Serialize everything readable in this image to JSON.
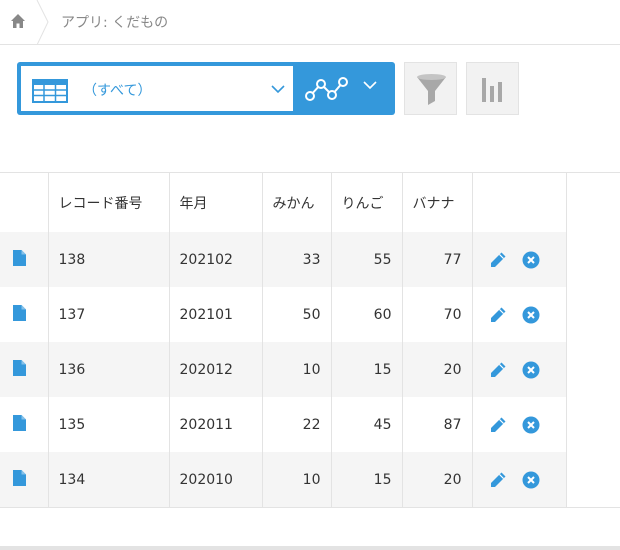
{
  "breadcrumb": {
    "home_icon": "home-icon",
    "app_label": "アプリ: くだもの"
  },
  "toolbar": {
    "view_icon": "table-view-icon",
    "view_name": "（すべて）",
    "graph_icon": "graph-icon",
    "filter_icon": "filter-funnel-icon",
    "summary_icon": "bar-chart-icon",
    "accent_color": "#3498db"
  },
  "table": {
    "columns": [
      "",
      "レコード番号",
      "年月",
      "みかん",
      "りんご",
      "バナナ",
      ""
    ],
    "rows": [
      {
        "record_no": "138",
        "yearmonth": "202102",
        "mikan": "33",
        "ringo": "55",
        "banana": "77"
      },
      {
        "record_no": "137",
        "yearmonth": "202101",
        "mikan": "50",
        "ringo": "60",
        "banana": "70"
      },
      {
        "record_no": "136",
        "yearmonth": "202012",
        "mikan": "10",
        "ringo": "15",
        "banana": "20"
      },
      {
        "record_no": "135",
        "yearmonth": "202011",
        "mikan": "22",
        "ringo": "45",
        "banana": "87"
      },
      {
        "record_no": "134",
        "yearmonth": "202010",
        "mikan": "10",
        "ringo": "15",
        "banana": "20"
      }
    ],
    "row_icons": {
      "detail": "document-icon",
      "edit": "pencil-icon",
      "delete": "close-circle-icon"
    }
  }
}
